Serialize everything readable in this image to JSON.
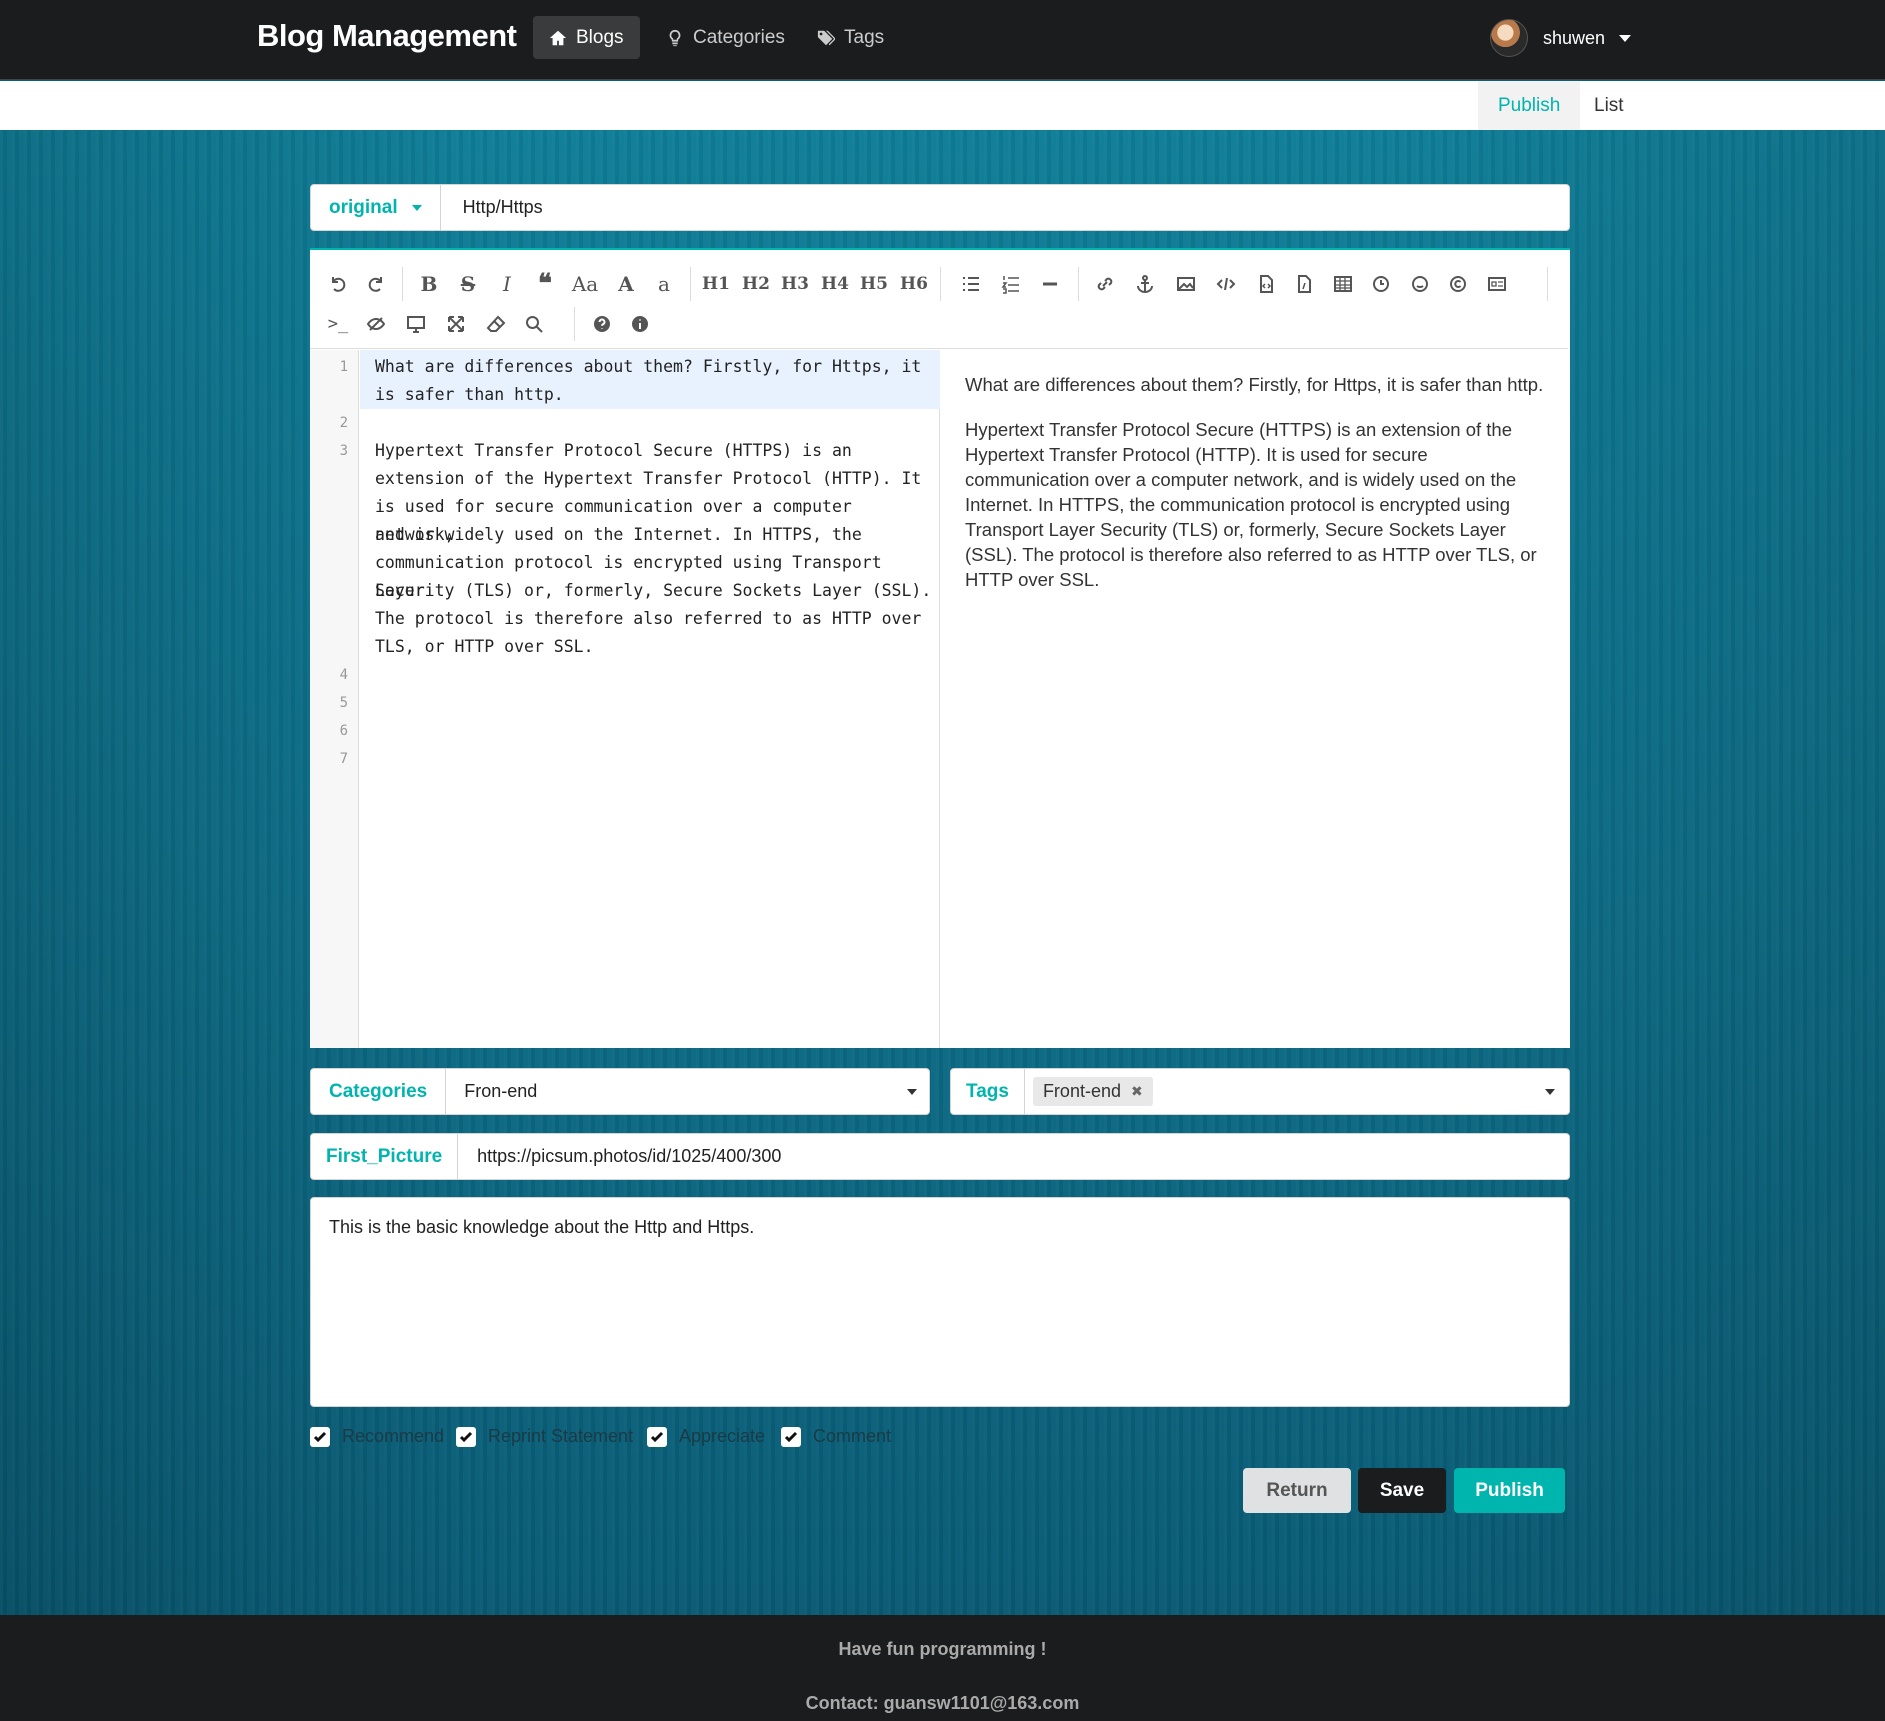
{
  "header": {
    "brand": "Blog Management",
    "nav": [
      {
        "label": "Blogs",
        "icon": "home-icon",
        "active": true
      },
      {
        "label": "Categories",
        "icon": "lightbulb-icon",
        "active": false
      },
      {
        "label": "Tags",
        "icon": "tags-icon",
        "active": false
      }
    ],
    "user": {
      "name": "shuwen"
    }
  },
  "subnav": {
    "publish": "Publish",
    "list": "List"
  },
  "title_field": {
    "type_label": "original",
    "value": "Http/Https"
  },
  "editor": {
    "toolbar": [
      "undo-icon",
      "redo-icon",
      "bold-icon",
      "strikethrough-icon",
      "italic-icon",
      "quote-icon",
      "uppercase-icon",
      "ucfirst-icon",
      "lowercase-icon",
      "h1",
      "h2",
      "h3",
      "h4",
      "h5",
      "h6",
      "list-ul-icon",
      "list-ol-icon",
      "hr-icon",
      "link-icon",
      "anchor-icon",
      "image-icon",
      "code-icon",
      "preformatted-icon",
      "code-block-icon",
      "table-icon",
      "datetime-icon",
      "emoji-icon",
      "html-entities-icon",
      "pagebreak-icon",
      "goto-line-icon",
      "watch-icon",
      "preview-icon",
      "fullscreen-icon",
      "clear-icon",
      "search-icon",
      "help-icon",
      "info-icon"
    ],
    "toolbar_text": {
      "uppercase": "Aa",
      "ucfirst": "A",
      "lowercase": "a",
      "h1": "H1",
      "h2": "H2",
      "h3": "H3",
      "h4": "H4",
      "h5": "H5",
      "h6": "H6"
    },
    "line_numbers": [
      "1",
      "2",
      "3",
      "4",
      "5",
      "6",
      "7"
    ],
    "code_lines": [
      "What are differences about them? Firstly, for Https, it",
      "is safer than http.",
      "Hypertext Transfer Protocol Secure (HTTPS) is an",
      "extension of the Hypertext Transfer Protocol (HTTP). It",
      "is used for secure communication over a computer network,",
      "and is widely used on the Internet. In HTTPS, the",
      "communication protocol is encrypted using Transport Layer",
      "Security (TLS) or, formerly, Secure Sockets Layer (SSL).",
      "The protocol is therefore also referred to as HTTP over",
      "TLS, or HTTP over SSL."
    ],
    "preview_paragraphs": [
      "What are differences about them? Firstly, for Https, it is safer than http.",
      "Hypertext Transfer Protocol Secure (HTTPS) is an extension of the Hypertext Transfer Protocol (HTTP). It is used for secure communication over a computer network, and is widely used on the Internet. In HTTPS, the communication protocol is encrypted using Transport Layer Security (TLS) or, formerly, Secure Sockets Layer (SSL). The protocol is therefore also referred to as HTTP over TLS, or HTTP over SSL."
    ]
  },
  "categories": {
    "label": "Categories",
    "value": "Fron-end"
  },
  "tags": {
    "label": "Tags",
    "chips": [
      "Front-end"
    ],
    "remove_glyph": "✖"
  },
  "first_picture": {
    "label": "First_Picture",
    "value": "https://picsum.photos/id/1025/400/300"
  },
  "description": "This is the basic knowledge about the Http and Https.",
  "checkboxes": [
    {
      "label": "Recommend",
      "checked": true
    },
    {
      "label": "Reprint Statement",
      "checked": true
    },
    {
      "label": "Appreciate",
      "checked": true
    },
    {
      "label": "Comment",
      "checked": true
    }
  ],
  "buttons": {
    "return": "Return",
    "save": "Save",
    "publish": "Publish"
  },
  "footer": {
    "line1": "Have fun programming !",
    "line2": "Contact: guansw1101@163.com"
  },
  "colors": {
    "accent": "#00b5ad",
    "dark": "#1b1c1d",
    "background": "#0b6d88"
  }
}
